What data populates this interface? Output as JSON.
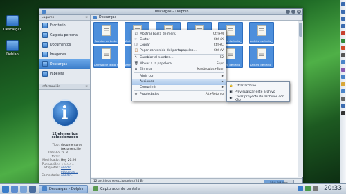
{
  "desktop": {
    "icons": [
      {
        "label": "Descargas",
        "icon": "folder-icon"
      },
      {
        "label": "Debian",
        "icon": "drive-icon"
      }
    ]
  },
  "window": {
    "title": "Descargas – Dolphin",
    "close_glyph": "✕",
    "sidebar": {
      "places_header": "Lugares",
      "places": [
        "Escritorio",
        "Carpeta personal",
        "Documentos",
        "Imágenes",
        "Descargas",
        "Papelera"
      ],
      "active_place": "Descargas",
      "info_header": "Información",
      "info_icon_glyph": "i",
      "info_title": "12 elementos seleccionados",
      "info": [
        {
          "key": "Tipo:",
          "value": "documento de texto sencillo"
        },
        {
          "key": "Tamaño total:",
          "value": "24 B"
        },
        {
          "key": "Modificado:",
          "value": "Hoy 20:26"
        },
        {
          "key": "Puntuación:",
          "value": "☆☆☆☆☆"
        },
        {
          "key": "Etiquetas:",
          "value": "Añadir etiquetas..."
        },
        {
          "key": "Comentario:",
          "value": "Añadir..."
        }
      ]
    },
    "toolbar": {
      "path": "Descargas"
    },
    "files": [
      "Archivo de texto",
      "Archivo de texto_1",
      "Archivo de texto_2",
      "Archivo de texto_3",
      "Archivo de texto_4",
      "Archivo de texto_5",
      "Archivo de texto_6",
      "Archivo de texto_7",
      "Archivo de texto_8",
      "Archivo de texto_9",
      "Archivo de texto_10",
      "Archivo de texto_11"
    ],
    "status": {
      "text": "12 archivos seleccionados (24 B)",
      "free_label": "50,6 GiB libre",
      "used_fraction": 0.7
    }
  },
  "context_menu": {
    "items": [
      {
        "icon": "checkbox-icon",
        "glyph": "☑",
        "label": "Mostrar barra de menú",
        "shortcut": "Ctrl+M"
      },
      {
        "icon": "cut-icon",
        "glyph": "✂",
        "label": "Cortar",
        "shortcut": "Ctrl+X"
      },
      {
        "icon": "copy-icon",
        "glyph": "❐",
        "label": "Copiar",
        "shortcut": "Ctrl+C"
      },
      {
        "icon": "paste-icon",
        "glyph": "📋",
        "label": "Pegar contenido del portapapeles...",
        "shortcut": "Ctrl+V"
      },
      {
        "sep": true
      },
      {
        "icon": "rename-icon",
        "glyph": "✎",
        "label": "Cambiar el nombre...",
        "shortcut": "F2"
      },
      {
        "icon": "trash-icon",
        "glyph": "🗑",
        "label": "Mover a la papelera",
        "shortcut": "Supr"
      },
      {
        "icon": "delete-icon",
        "glyph": "✖",
        "label": "Eliminar",
        "shortcut": "Mayúsculas+Supr"
      },
      {
        "sep": true
      },
      {
        "icon": "",
        "glyph": "",
        "label": "Abrir con",
        "shortcut": "▸"
      },
      {
        "icon": "",
        "glyph": "",
        "label": "Acciones",
        "shortcut": "▸",
        "highlight": true
      },
      {
        "icon": "",
        "glyph": "",
        "label": "Comprimir",
        "shortcut": "▸"
      },
      {
        "sep": true
      },
      {
        "icon": "properties-icon",
        "glyph": "⚙",
        "label": "Propiedades",
        "shortcut": "Alt+Retorno"
      }
    ]
  },
  "submenu": {
    "items": [
      {
        "icon": "encrypt-icon",
        "glyph": "🔒",
        "label": "Cifrar archivo"
      },
      {
        "icon": "preview-icon",
        "glyph": "▣",
        "label": "Previsualizar este archivo"
      },
      {
        "icon": "k3b-icon",
        "glyph": "◉",
        "label": "Crear proyecto de archivos con K3b"
      }
    ]
  },
  "taskbar": {
    "tasks": [
      {
        "label": "Descargas – Dolphin",
        "active": true
      },
      {
        "label": "Capturador de pantalla",
        "active": false
      }
    ],
    "clock": "20:33"
  },
  "colors": {
    "accent": "#4d8fdc",
    "selection": "#3a7cc9"
  }
}
